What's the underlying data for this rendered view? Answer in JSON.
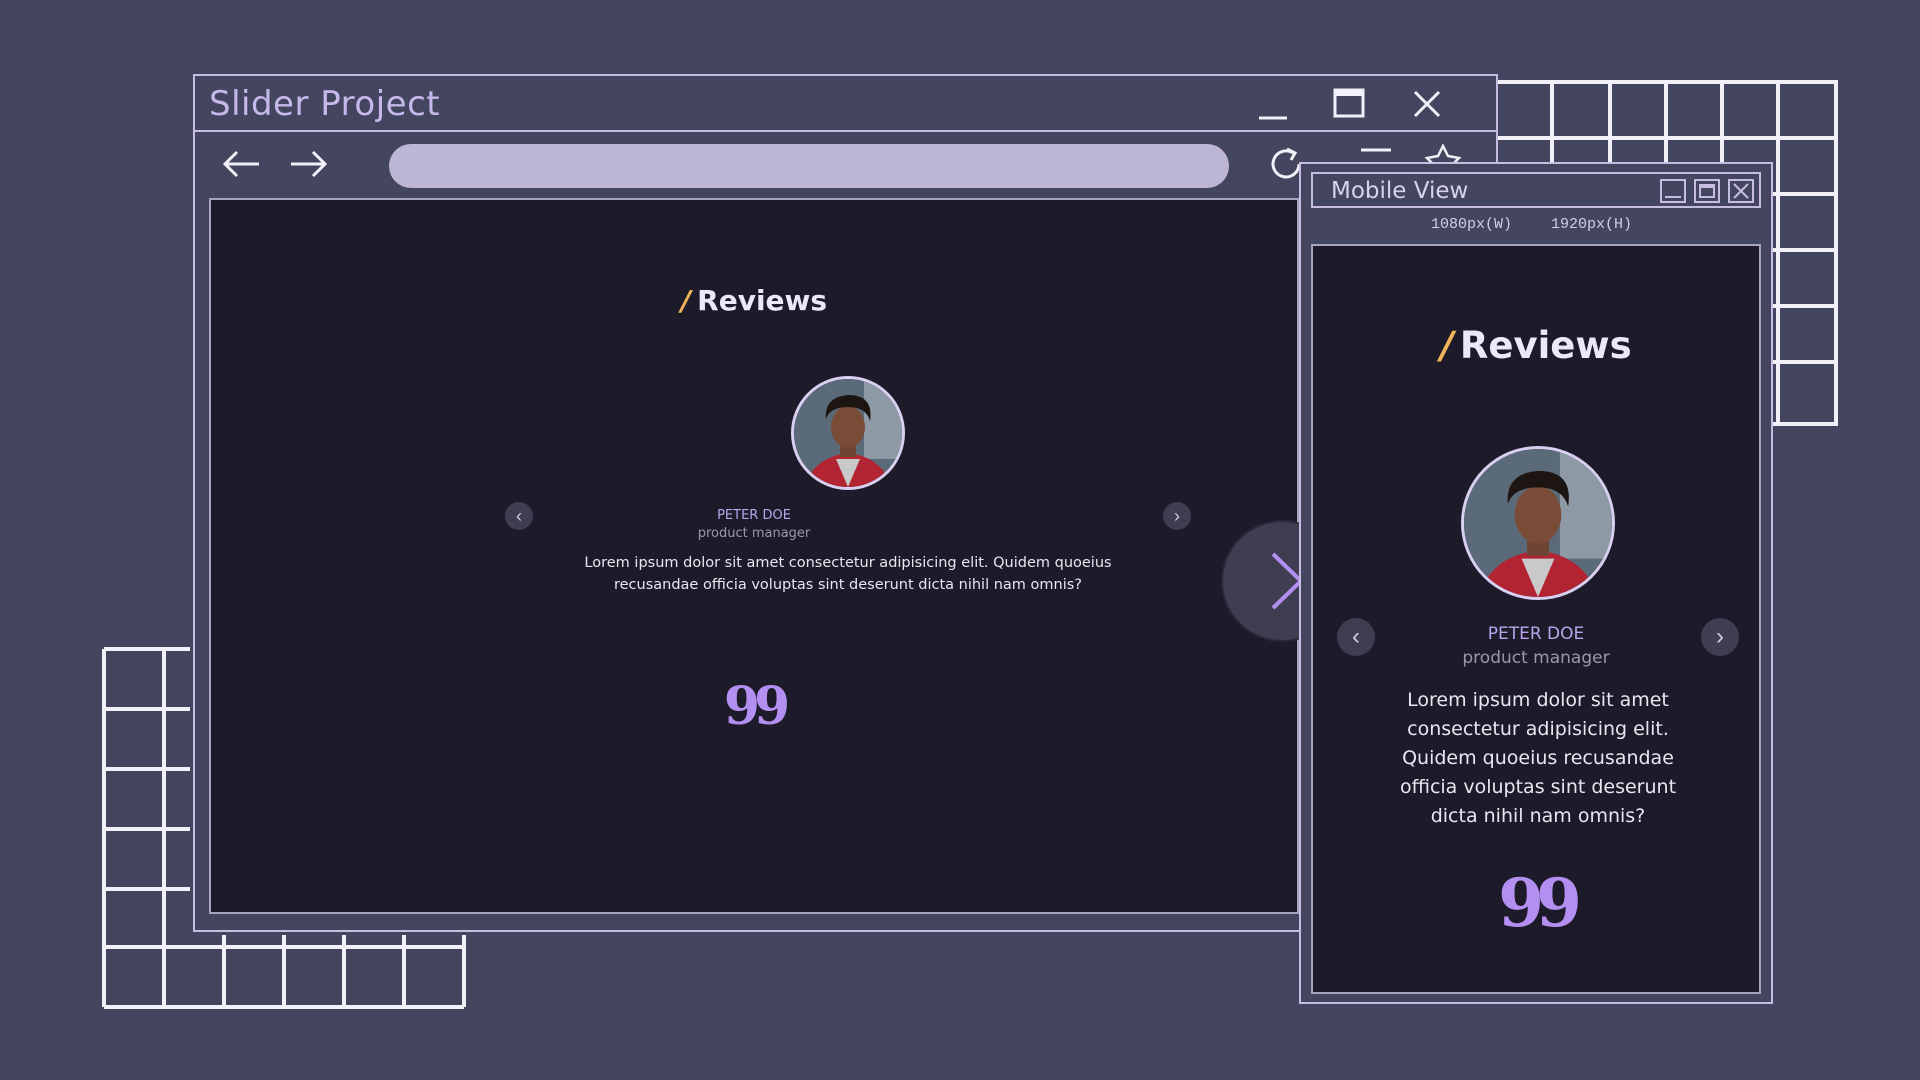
{
  "desktop_window": {
    "title": "Slider Project",
    "controls": [
      "minimize-icon",
      "maximize-icon",
      "close-icon"
    ],
    "toolbar": {
      "icons": [
        "back-arrow-icon",
        "forward-arrow-icon",
        "reload-icon",
        "menu-icon",
        "star-icon"
      ],
      "url_value": ""
    }
  },
  "desktop_page": {
    "heading_slash": "/",
    "heading": "Reviews",
    "person_name": "PETER DOE",
    "person_role": "product manager",
    "review_line1": "Lorem ipsum dolor sit amet consectetur adipisicing elit. Quidem quoeius",
    "review_line2": "recusandae officia voluptas sint deserunt dicta nihil nam omnis?",
    "quote_mark": "99",
    "prev_label": "‹",
    "next_label": "›"
  },
  "big_next_icon": "chevron-right-icon",
  "mobile_window": {
    "title": "Mobile View",
    "width_label": "1080px(W)",
    "height_label": "1920px(H)"
  },
  "mobile_page": {
    "heading_slash": "/",
    "heading": "Reviews",
    "person_name": "PETER DOE",
    "person_role": "product manager",
    "review_lines": [
      "Lorem ipsum dolor sit amet",
      "consectetur adipisicing elit.",
      "Quidem quoeius recusandae",
      "officia voluptas sint deserunt",
      "dicta nihil nam omnis?"
    ],
    "quote_mark": "99",
    "prev_label": "‹",
    "next_label": "›"
  },
  "colors": {
    "background": "#44455e",
    "window_border": "#c7bde3",
    "page_bg": "#1d1b29",
    "accent_slash": "#f0b25a",
    "accent_purple": "#b28ff0"
  }
}
